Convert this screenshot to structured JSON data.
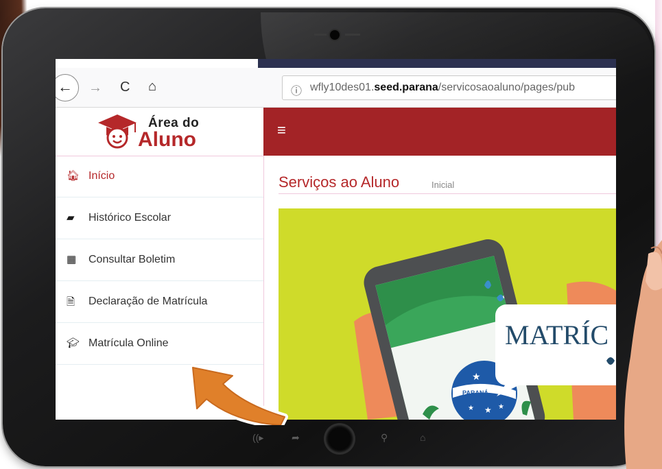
{
  "browser": {
    "url_prefix": "wfly10des01.",
    "url_bold": "seed.parana",
    "url_suffix": "/servicosaoaluno/pages/pub",
    "back_glyph": "←",
    "forward_glyph": "→",
    "reload_glyph": "C",
    "home_glyph": "⌂",
    "info_glyph": "ⓘ"
  },
  "logo": {
    "line1": "Área do",
    "line2": "Aluno"
  },
  "sidebar": {
    "items": [
      {
        "label": "Início",
        "icon": "home-icon",
        "glyph": "🏠︎"
      },
      {
        "label": "Histórico Escolar",
        "icon": "folder-open-icon",
        "glyph": "▰"
      },
      {
        "label": "Consultar Boletim",
        "icon": "grid-icon",
        "glyph": "▦"
      },
      {
        "label": "Declaração de Matrícula",
        "icon": "document-icon",
        "glyph": "🗎"
      },
      {
        "label": "Matrícula Online",
        "icon": "graduation-cap-icon",
        "glyph": "🎓︎"
      }
    ]
  },
  "topbar": {
    "menu_glyph": "≡"
  },
  "content": {
    "title": "Serviços ao Aluno",
    "subtitle": "Inicial"
  },
  "banner": {
    "headline": "MATRÍC",
    "state_label": "PARANÁ"
  },
  "tablet_nav": {
    "glyphs": [
      "((▸",
      "➦",
      "⚲",
      "⌂"
    ]
  },
  "colors": {
    "accent_red": "#a32326",
    "banner_green": "#cfdb2a",
    "arrow_orange": "#e0802a"
  }
}
